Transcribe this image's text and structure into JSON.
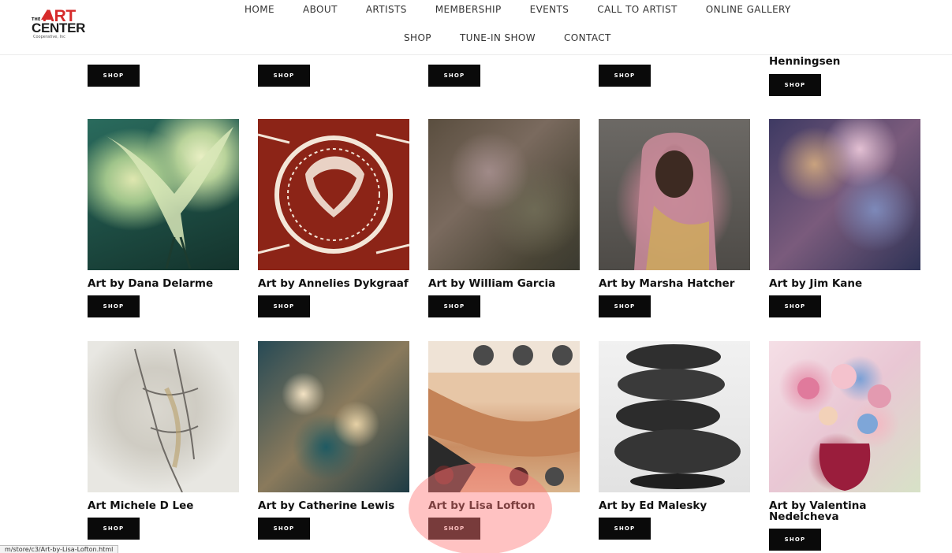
{
  "logo": {
    "the": "THE",
    "art": "ART",
    "center": "CENTER",
    "subtitle": "Cooperative, Inc"
  },
  "nav": {
    "row1": [
      "HOME",
      "ABOUT",
      "ARTISTS",
      "MEMBERSHIP",
      "EVENTS",
      "CALL TO ARTIST",
      "ONLINE GALLERY"
    ],
    "row2": [
      "SHOP",
      "TUNE-IN SHOW",
      "CONTACT"
    ]
  },
  "partial_row": {
    "last_title": "Henningsen",
    "shop_label": "SHOP"
  },
  "products": [
    {
      "title": "Art by Dana Delarme",
      "shop_label": "SHOP"
    },
    {
      "title": "Art by Annelies Dykgraaf",
      "shop_label": "SHOP"
    },
    {
      "title": "Art by William Garcia",
      "shop_label": "SHOP"
    },
    {
      "title": "Art by Marsha Hatcher",
      "shop_label": "SHOP"
    },
    {
      "title": "Art by Jim Kane",
      "shop_label": "SHOP"
    },
    {
      "title": "Art Michele D Lee",
      "shop_label": "SHOP"
    },
    {
      "title": "Art by Catherine Lewis",
      "shop_label": "SHOP"
    },
    {
      "title": "Art by Lisa Lofton",
      "shop_label": "SHOP"
    },
    {
      "title": "Art by Ed Malesky",
      "shop_label": "SHOP"
    },
    {
      "title": "Art by Valentina Nedelcheva",
      "shop_label": "SHOP"
    }
  ],
  "status_url": "m/store/c3/Art-by-Lisa-Lofton.html",
  "colors": {
    "shop_button": "#0a0a0a",
    "logo_red": "#d62b2b",
    "highlight": "#ff7878"
  }
}
